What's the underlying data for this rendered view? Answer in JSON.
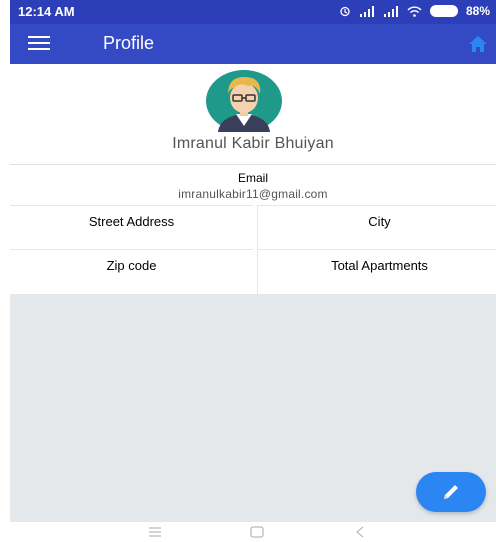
{
  "status_bar": {
    "time": "12:14 AM",
    "battery_percent": "88%",
    "icons": [
      "alarm-icon",
      "signal-icon",
      "signal-icon",
      "wifi-icon",
      "battery-icon"
    ]
  },
  "app_bar": {
    "title": "Profile",
    "menu_icon": "hamburger-menu-icon",
    "home_icon": "home-icon"
  },
  "profile": {
    "name": "Imranul Kabir Bhuiyan",
    "avatar_icon": "avatar-icon"
  },
  "details": {
    "email_label": "Email",
    "email_value": "imranulkabir11@gmail.com",
    "street_label": "Street Address",
    "city_label": "City",
    "zip_label": "Zip code",
    "apartments_label": "Total Apartments"
  },
  "fab": {
    "icon": "edit-pencil-icon"
  },
  "nav": {
    "icons": [
      "recent-apps-icon",
      "home-square-icon",
      "back-icon"
    ]
  },
  "colors": {
    "status_bar": "#2d3fb8",
    "app_bar": "#3449c4",
    "fab": "#2b85f2",
    "content_bg": "#e4e8eb"
  }
}
